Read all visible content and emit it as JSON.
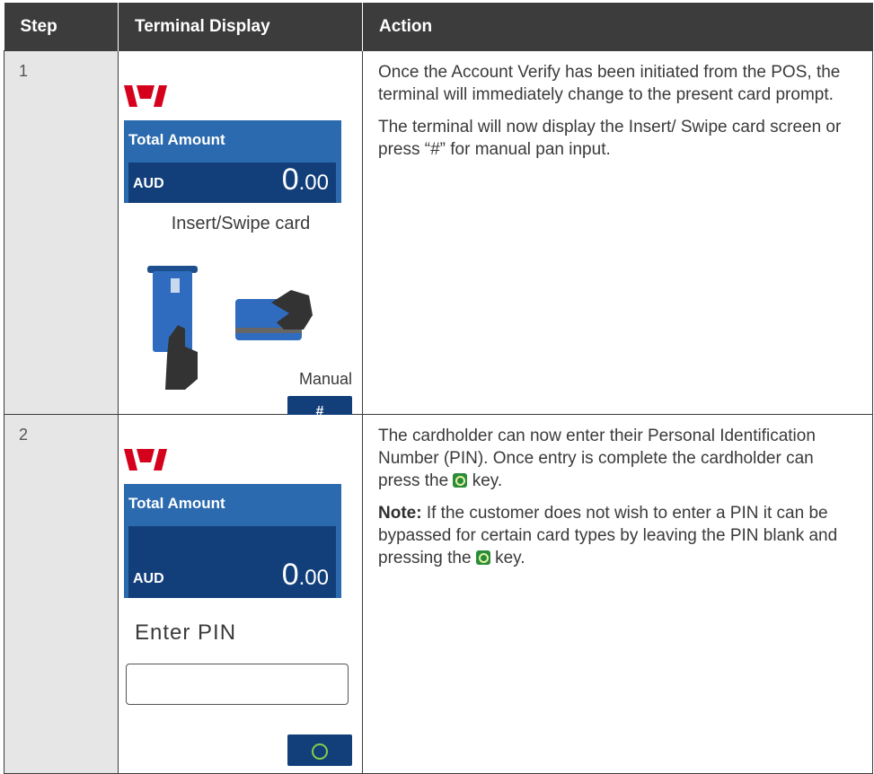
{
  "headers": {
    "step": "Step",
    "display": "Terminal Display",
    "action": "Action"
  },
  "rows": [
    {
      "step": "1",
      "screen": {
        "title": "Total Amount",
        "currency": "AUD",
        "amount_main": "0",
        "amount_cents": ".00"
      },
      "prompt": "Insert/Swipe card",
      "manual_label": "Manual",
      "manual_key": "#",
      "action": [
        "Once the Account Verify has been initiated from the POS, the terminal will immediately change to the present card prompt.",
        "The terminal will now display the Insert/ Swipe card screen or press “#” for manual pan input."
      ]
    },
    {
      "step": "2",
      "screen": {
        "title": "Total Amount",
        "currency": "AUD",
        "amount_main": "0",
        "amount_cents": ".00"
      },
      "prompt": "Enter PIN",
      "action_p1_a": "The cardholder can now enter their Personal Identification Number (PIN). Once entry is complete the cardholder can press the",
      "action_p1_b": " key.",
      "note_label": "Note:",
      "action_p2_a": " If the customer does not wish to enter a PIN it can be bypassed for certain card types by leaving the PIN blank and pressing the",
      "action_p2_b": " key."
    }
  ],
  "colors": {
    "header_bg": "#3c3c3c",
    "screen_blue": "#2b6aae",
    "screen_dark": "#123f7a",
    "brand_red": "#d5001c",
    "ok_green": "#2a8c3a"
  }
}
